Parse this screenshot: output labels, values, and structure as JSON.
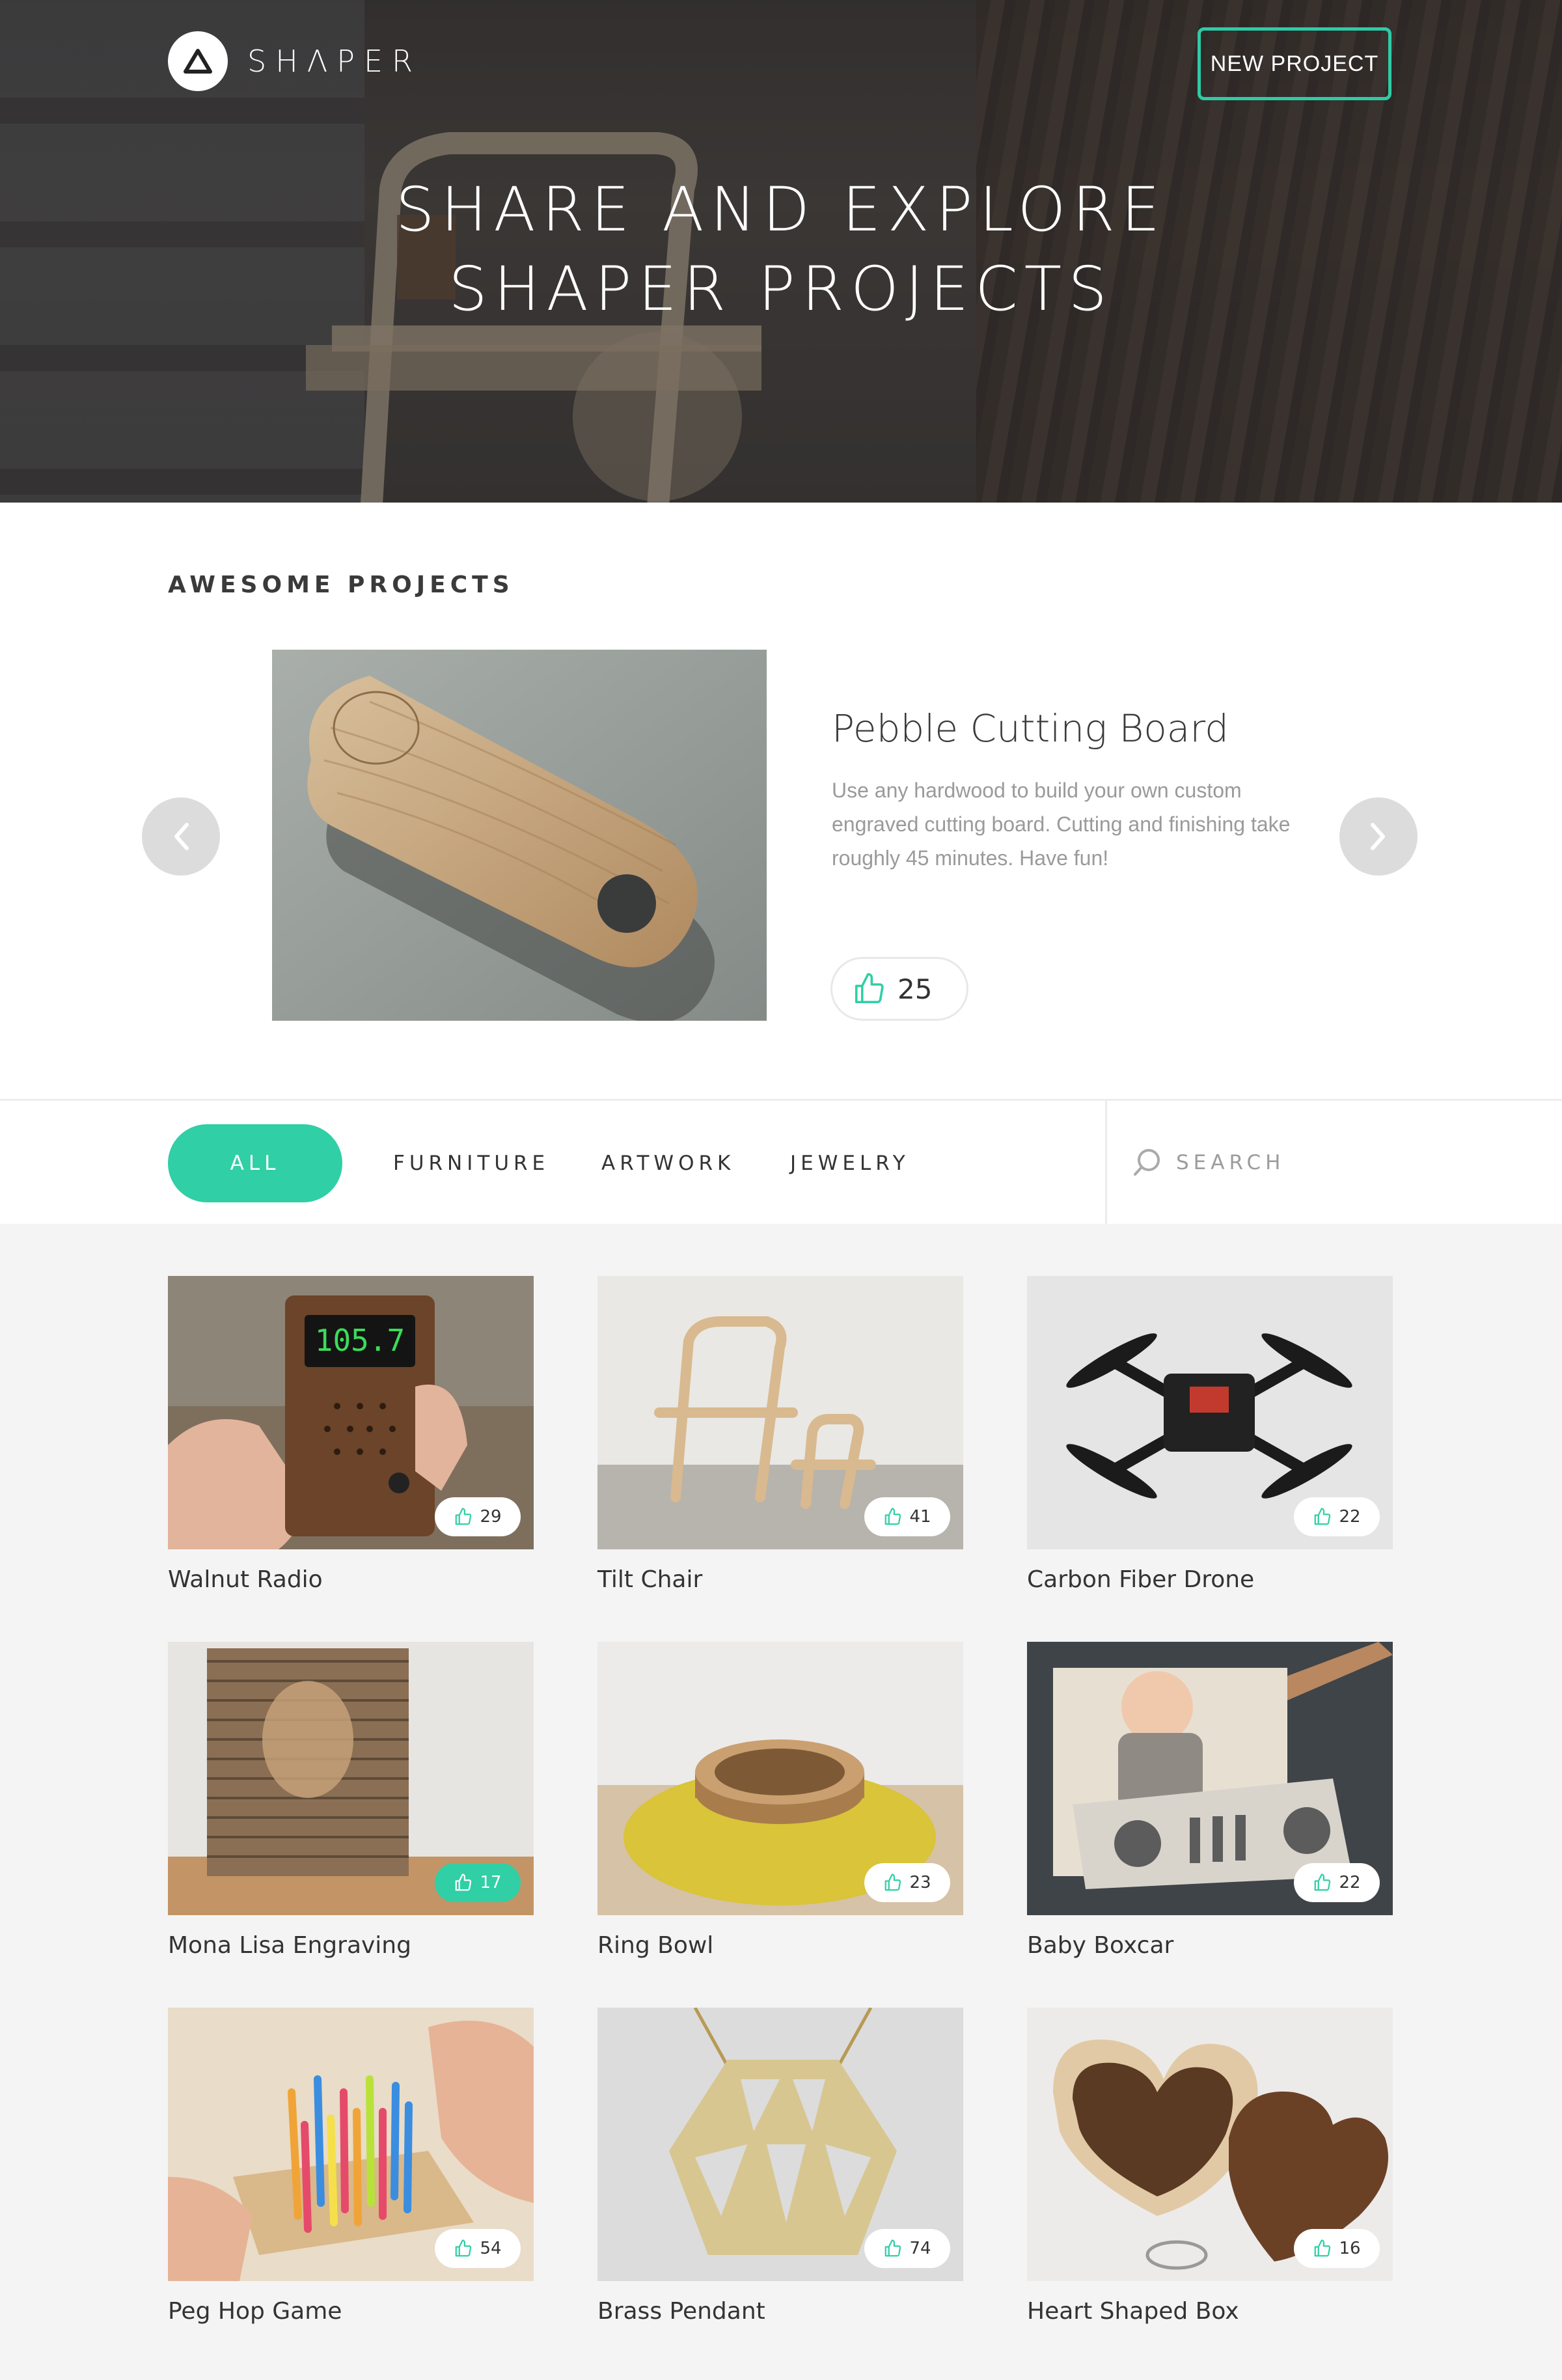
{
  "header": {
    "logo_text": "SHΛPER",
    "new_project_label": "NEW PROJECT",
    "hero_title_line1": "SHARE AND EXPLORE",
    "hero_title_line2": "SHAPER PROJECTS"
  },
  "featured": {
    "section_title": "AWESOME PROJECTS",
    "title": "Pebble Cutting Board",
    "description": "Use any hardwood to build your own custom engraved cutting board. Cutting and finishing take roughly 45 minutes. Have fun!",
    "likes": "25"
  },
  "filters": {
    "tabs": [
      {
        "label": "ALL",
        "active": true
      },
      {
        "label": "FURNITURE",
        "active": false
      },
      {
        "label": "ARTWORK",
        "active": false
      },
      {
        "label": "JEWELRY",
        "active": false
      }
    ],
    "search_placeholder": "SEARCH"
  },
  "projects": [
    {
      "title": "Walnut Radio",
      "likes": "29",
      "liked": false
    },
    {
      "title": "Tilt Chair",
      "likes": "41",
      "liked": false
    },
    {
      "title": "Carbon Fiber Drone",
      "likes": "22",
      "liked": false
    },
    {
      "title": "Mona Lisa Engraving",
      "likes": "17",
      "liked": true
    },
    {
      "title": "Ring Bowl",
      "likes": "23",
      "liked": false
    },
    {
      "title": "Baby Boxcar",
      "likes": "22",
      "liked": false
    },
    {
      "title": "Peg Hop Game",
      "likes": "54",
      "liked": false
    },
    {
      "title": "Brass Pendant",
      "likes": "74",
      "liked": false
    },
    {
      "title": "Heart Shaped Box",
      "likes": "16",
      "liked": false
    }
  ],
  "radio_display": "105.7",
  "colors": {
    "accent": "#30cfa5",
    "text": "#333333",
    "muted": "#9a9a9a",
    "grid_bg": "#f4f4f4"
  }
}
